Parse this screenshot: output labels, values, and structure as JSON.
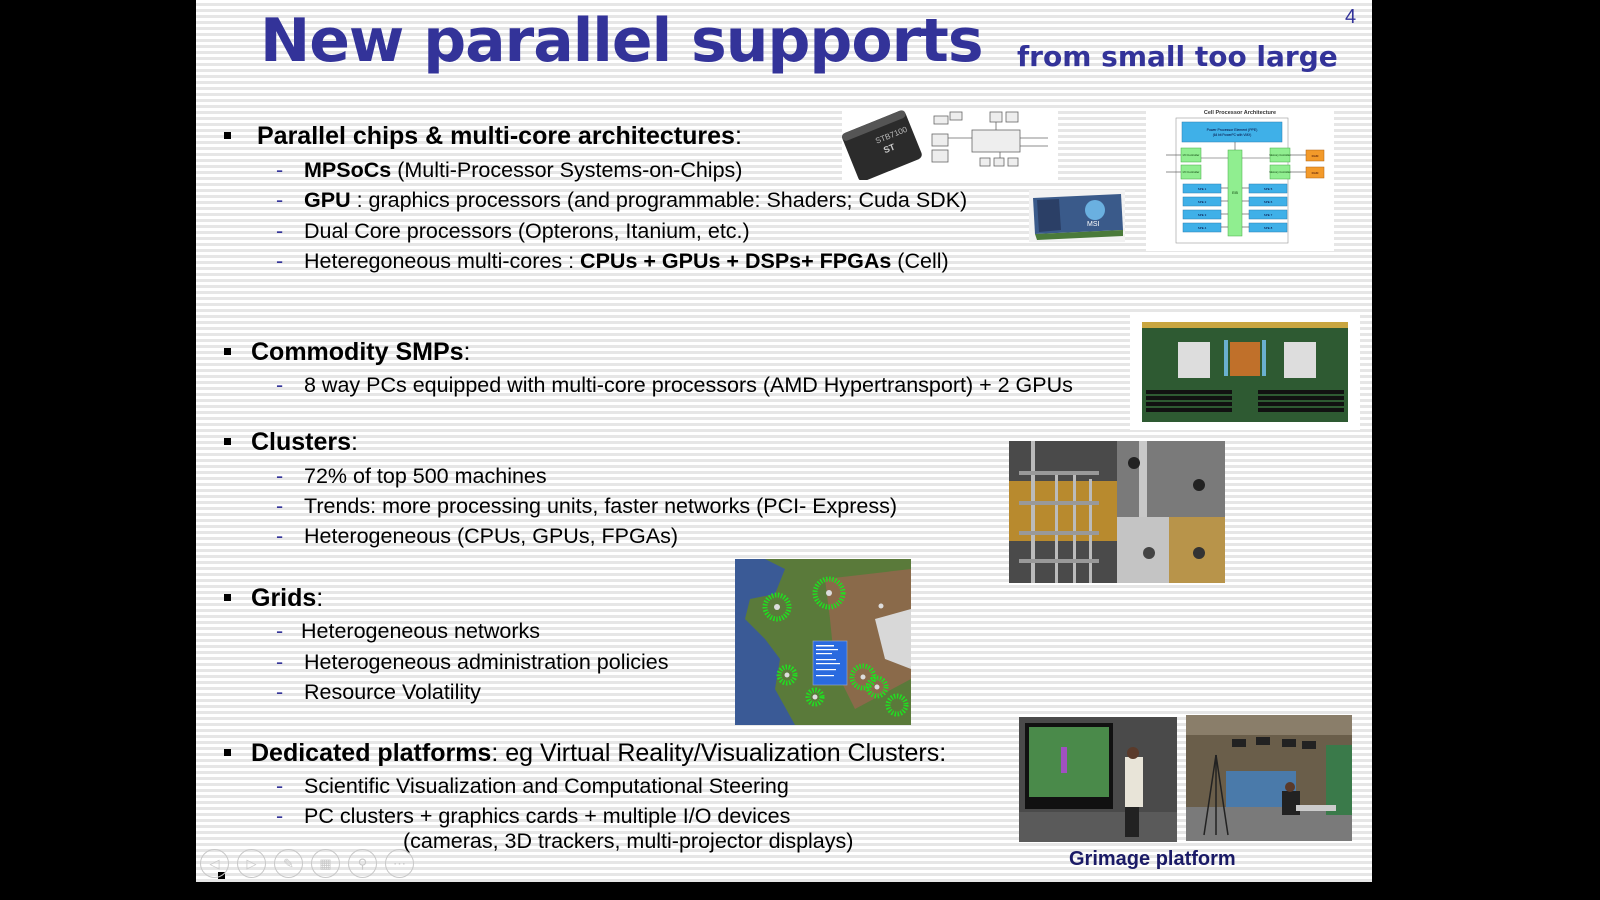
{
  "slide": {
    "title": "New parallel supports",
    "subtitle": "from small too large",
    "page_number": "4",
    "sections": [
      {
        "heading_bold": "Parallel chips & multi-core architectures",
        "heading_rest": ":",
        "items": [
          {
            "bold": "MPSoCs",
            "rest": " (Multi-Processor Systems-on-Chips)"
          },
          {
            "bold": "GPU",
            "rest": " : graphics processors (and programmable: Shaders;  Cuda SDK)"
          },
          {
            "bold": "",
            "rest": "Dual Core processors (Opterons, Itanium, etc.)"
          },
          {
            "pre": "Heteregoneous multi-cores : ",
            "bold": "CPUs + GPUs + DSPs+ FPGAs",
            "rest": "  (Cell)"
          }
        ]
      },
      {
        "heading_bold": "Commodity SMPs",
        "heading_rest": ":",
        "items": [
          {
            "rest": "8 way PCs equipped with multi-core processors (AMD Hypertransport) + 2 GPUs"
          }
        ]
      },
      {
        "heading_bold": "Clusters",
        "heading_rest": ":",
        "items": [
          {
            "rest": "72% of top 500 machines"
          },
          {
            "rest": "Trends: more processing units, faster networks (PCI- Express)"
          },
          {
            "rest": "Heterogeneous (CPUs, GPUs, FPGAs)"
          }
        ]
      },
      {
        "heading_bold": "Grids",
        "heading_rest": ":",
        "items": [
          {
            "rest": "Heterogeneous networks"
          },
          {
            "rest": "Heterogeneous administration policies"
          },
          {
            "rest": "Resource Volatility"
          }
        ]
      },
      {
        "heading_bold": "Dedicated platforms",
        "heading_rest": ": eg Virtual Reality/Visualization Clusters:",
        "items": [
          {
            "rest": "Scientific Visualization and Computational Steering"
          },
          {
            "rest": "PC clusters + graphics cards + multiple I/O devices"
          },
          {
            "rest": "(cameras, 3D trackers, multi-projector displays)"
          }
        ]
      }
    ],
    "images": {
      "chip_label": "STB7100",
      "chip_logo": "ST",
      "gpu_brand": "MSI",
      "cell_title": "Cell Processor Architecture",
      "cell_ppe": "Power Processor Element (PPE)",
      "cell_ppe_sub": "(64 bit PowerPC with VMX)",
      "cell_io": "I/O Controller",
      "cell_mem": "Memory Controller",
      "cell_ram": "RAM",
      "cell_eib": "EIB",
      "cell_spes": [
        "SPE 1",
        "SPE 2",
        "SPE 3",
        "SPE 4",
        "SPE 5",
        "SPE 6",
        "SPE 7",
        "SPE 8"
      ],
      "grimage_caption": "Grimage platform"
    },
    "nav_controls": [
      {
        "name": "previous-slide-button",
        "glyph": "◁"
      },
      {
        "name": "next-slide-button",
        "glyph": "▷"
      },
      {
        "name": "pen-tool-button",
        "glyph": "✎"
      },
      {
        "name": "slide-sorter-button",
        "glyph": "▦"
      },
      {
        "name": "zoom-button",
        "glyph": "⚲"
      },
      {
        "name": "more-options-button",
        "glyph": "⋯"
      }
    ]
  }
}
